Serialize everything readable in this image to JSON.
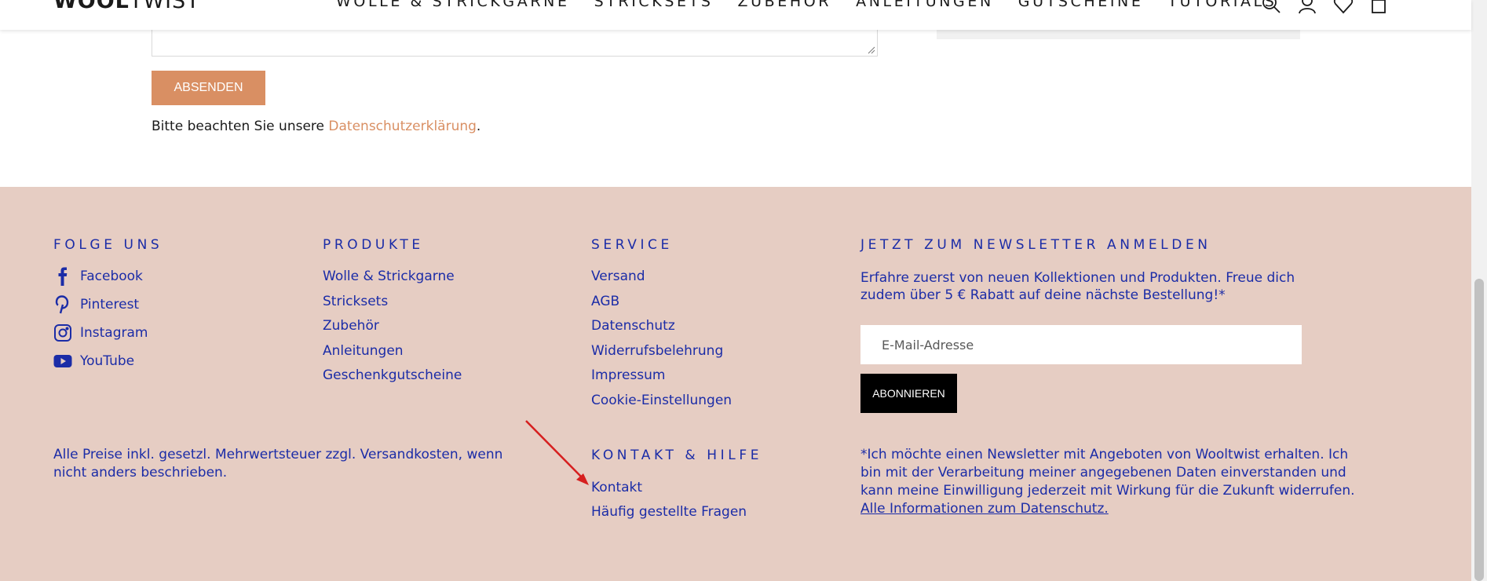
{
  "header": {
    "logo_bold": "WOOL",
    "logo_light": "TWIST",
    "nav": [
      "WOLLE & STRICKGARNE",
      "STRICKSETS",
      "ZUBEHÖR",
      "ANLEITUNGEN",
      "GUTSCHEINE",
      "TUTORIALS"
    ],
    "icons": [
      "search-icon",
      "account-icon",
      "wishlist-icon",
      "cart-icon"
    ]
  },
  "form": {
    "submit_label": "ABSENDEN",
    "privacy_prefix": "Bitte beachten Sie unsere ",
    "privacy_link": "Datenschutzerklärung",
    "privacy_suffix": "."
  },
  "footer": {
    "follow": {
      "heading": "FOLGE UNS",
      "items": [
        {
          "label": "Facebook",
          "icon": "facebook-icon"
        },
        {
          "label": "Pinterest",
          "icon": "pinterest-icon"
        },
        {
          "label": "Instagram",
          "icon": "instagram-icon"
        },
        {
          "label": "YouTube",
          "icon": "youtube-icon"
        }
      ]
    },
    "products": {
      "heading": "PRODUKTE",
      "items": [
        "Wolle & Strickgarne",
        "Stricksets",
        "Zubehör",
        "Anleitungen",
        "Geschenkgutscheine"
      ]
    },
    "service": {
      "heading": "SERVICE",
      "items": [
        "Versand",
        "AGB",
        "Datenschutz",
        "Widerrufsbelehrung",
        "Impressum",
        "Cookie-Einstellungen"
      ]
    },
    "contact": {
      "heading": "KONTAKT & HILFE",
      "items": [
        "Kontakt",
        "Häufig gestellte Fragen"
      ]
    },
    "newsletter": {
      "heading": "JETZT ZUM NEWSLETTER ANMELDEN",
      "text": "Erfahre zuerst von neuen Kollektionen und Produkten. Freue dich zudem über 5 € Rabatt auf deine nächste Bestellung!*",
      "email_placeholder": "E-Mail-Adresse",
      "subscribe_label": "ABONNIEREN",
      "consent": "*Ich möchte einen Newsletter mit Angeboten von Wooltwist erhalten. Ich bin mit der Verarbeitung meiner angegebenen Daten einverstanden und kann meine Einwilligung jederzeit mit Wirkung für die Zukunft widerrufen.",
      "consent_link": "Alle Informationen zum Datenschutz."
    },
    "price_note": "Alle Preise inkl. gesetzl. Mehrwertsteuer zzgl. Versandkosten, wenn nicht anders beschrieben."
  },
  "colors": {
    "footer_bg": "#e6cdc3",
    "footer_text": "#1b2ca7",
    "accent": "#d98f63",
    "annotation_arrow": "#d61f1f"
  }
}
